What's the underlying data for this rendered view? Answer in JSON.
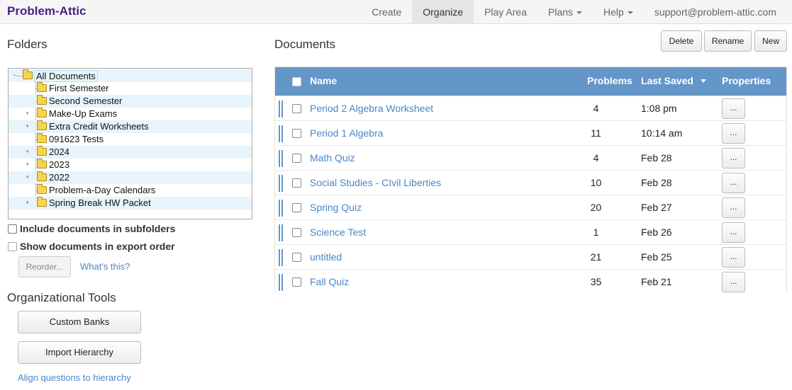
{
  "brand": "Problem-Attic",
  "nav": {
    "create": "Create",
    "organize": "Organize",
    "play_area": "Play Area",
    "plans": "Plans",
    "help": "Help",
    "account": "support@problem-attic.com"
  },
  "folders": {
    "heading": "Folders",
    "tree": [
      "All Documents",
      "First Semester",
      "Second Semester",
      "Make-Up Exams",
      "Extra Credit Worksheets",
      "091623 Tests",
      "2024",
      "2023",
      "2022",
      "Problem-a-Day Calendars",
      "Spring Break HW Packet"
    ],
    "include_subfolders": "Include documents in subfolders",
    "export_order": "Show documents in export order",
    "reorder_button": "Reorder...",
    "whats_this": "What's this?"
  },
  "tools": {
    "heading": "Organizational Tools",
    "custom_banks": "Custom Banks",
    "import_hierarchy": "Import Hierarchy",
    "align_link": "Align questions to hierarchy"
  },
  "documents": {
    "heading": "Documents",
    "delete": "Delete",
    "rename": "Rename",
    "new": "New",
    "columns": {
      "name": "Name",
      "problems": "Problems",
      "last_saved": "Last Saved",
      "properties": "Properties"
    },
    "properties_button": "...",
    "rows": [
      {
        "name": "Period 2 Algebra Worksheet",
        "problems": "4",
        "saved": "1:08 pm"
      },
      {
        "name": "Period 1 Algebra",
        "problems": "11",
        "saved": "10:14 am"
      },
      {
        "name": "Math Quiz",
        "problems": "4",
        "saved": "Feb 28"
      },
      {
        "name": "Social Studies - CIvil Liberties",
        "problems": "10",
        "saved": "Feb 28"
      },
      {
        "name": "Spring Quiz",
        "problems": "20",
        "saved": "Feb 27"
      },
      {
        "name": "Science Test",
        "problems": "1",
        "saved": "Feb 26"
      },
      {
        "name": "untitled",
        "problems": "21",
        "saved": "Feb 25"
      },
      {
        "name": "Fall Quiz",
        "problems": "35",
        "saved": "Feb 21"
      }
    ]
  }
}
